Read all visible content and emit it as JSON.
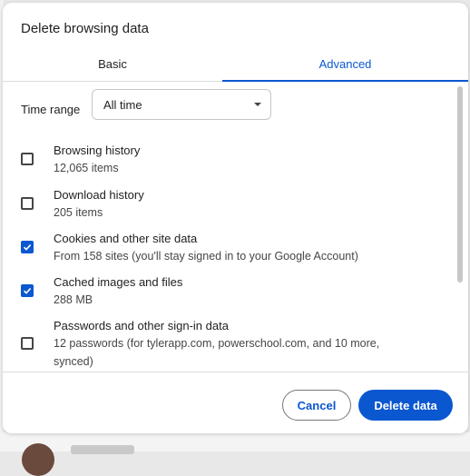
{
  "dialog": {
    "title": "Delete browsing data",
    "tabs": [
      {
        "label": "Basic",
        "active": false
      },
      {
        "label": "Advanced",
        "active": true
      }
    ],
    "time_range": {
      "label": "Time range",
      "value": "All time"
    },
    "items": [
      {
        "title": "Browsing history",
        "detail": "12,065 items",
        "checked": false
      },
      {
        "title": "Download history",
        "detail": "205 items",
        "checked": false
      },
      {
        "title": "Cookies and other site data",
        "detail": "From 158 sites (you'll stay signed in to your Google Account)",
        "checked": true
      },
      {
        "title": "Cached images and files",
        "detail": "288 MB",
        "checked": true
      },
      {
        "title": "Passwords and other sign-in data",
        "detail": "12 passwords (for tylerapp.com, powerschool.com, and 10 more, synced)",
        "checked": false
      }
    ],
    "buttons": {
      "cancel": "Cancel",
      "delete": "Delete data"
    }
  },
  "colors": {
    "accent": "#0b57d0",
    "checkbox_border": "#444746",
    "divider": "#dadce0"
  }
}
